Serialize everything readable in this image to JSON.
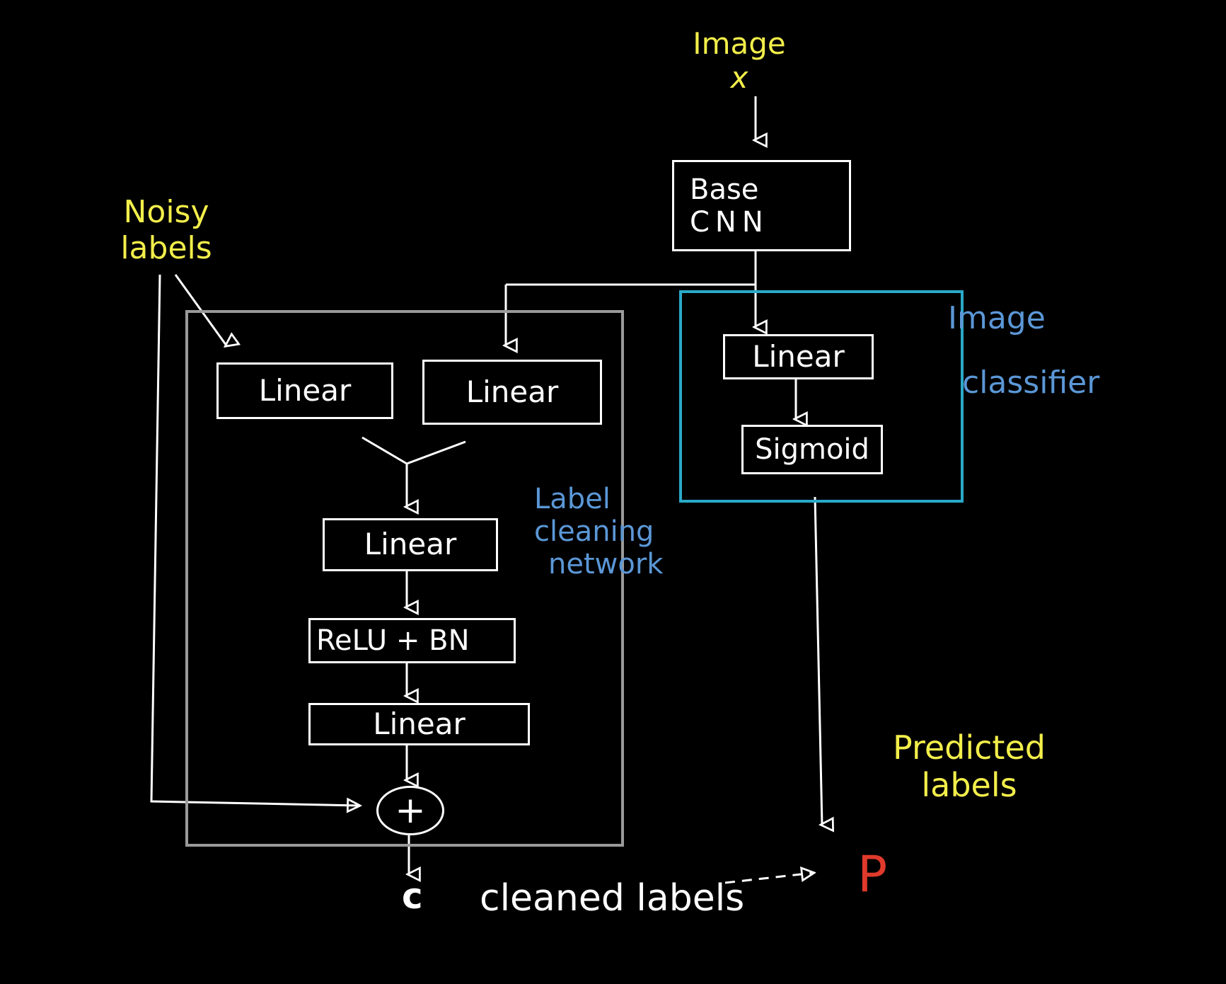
{
  "inputs": {
    "image_line1": "Image",
    "image_line2": "x",
    "noisy_line1": "Noisy",
    "noisy_line2": "labels"
  },
  "base_cnn": {
    "line1": "Base",
    "line2": "CNN"
  },
  "label_cleaning": {
    "title_line1": "Label",
    "title_line2": "cleaning",
    "title_line3": "network",
    "linear_left": "Linear",
    "linear_right": "Linear",
    "linear_mid": "Linear",
    "relu_bn": "ReLU + BN",
    "linear_bottom": "Linear",
    "sum_symbol": "+"
  },
  "image_classifier": {
    "title_line1": "Image",
    "title_line2": "classifier",
    "linear": "Linear",
    "sigmoid": "Sigmoid"
  },
  "outputs": {
    "c_symbol": "c",
    "cleaned_labels": "cleaned labels",
    "predicted_line1": "Predicted",
    "predicted_line2": "labels",
    "p_symbol": "P"
  },
  "colors": {
    "background": "#000000",
    "stroke": "#ffffff",
    "input_text": "#f2ee4a",
    "group_title": "#5b97d6",
    "label_group_border": "#9a9a9a",
    "classifier_group_border": "#2aa9c9",
    "prediction": "#e03a2c"
  }
}
